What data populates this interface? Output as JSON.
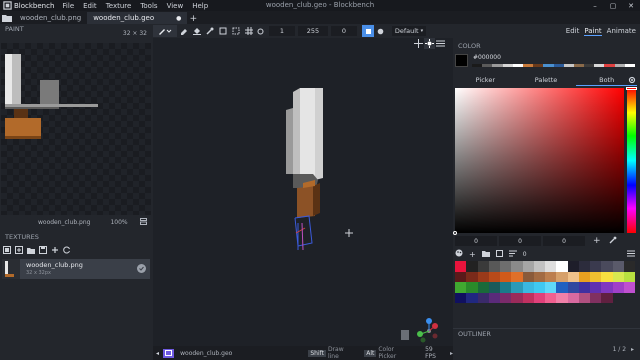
{
  "app": {
    "name": "Blockbench",
    "window_title": "wooden_club.geo - Blockbench",
    "menu": [
      "File",
      "Edit",
      "Texture",
      "Tools",
      "View",
      "Help"
    ],
    "window_controls": [
      "–",
      "▢",
      "✕"
    ]
  },
  "tabs": [
    {
      "label": "wooden_club.png",
      "active": false
    },
    {
      "label": "wooden_club.geo",
      "active": true,
      "modified_dot": "●",
      "close": "×"
    }
  ],
  "left_panel": {
    "paint_title": "PAINT",
    "paint_size": "32 × 32",
    "paint_file": "wooden_club.png",
    "paint_zoom": "100%",
    "textures_title": "TEXTURES",
    "texture": {
      "name": "wooden_club.png",
      "size": "32 x 32px"
    }
  },
  "toolbar": {
    "fields": [
      "1",
      "255",
      "0"
    ],
    "view_mode": "Default"
  },
  "mode_tabs": [
    {
      "label": "Edit",
      "active": false
    },
    {
      "label": "Paint",
      "active": true
    },
    {
      "label": "Animate",
      "active": false
    }
  ],
  "color_panel": {
    "title": "COLOR",
    "hex": "#000000",
    "subtabs": [
      {
        "label": "Picker",
        "active": false
      },
      {
        "label": "Palette",
        "active": false
      },
      {
        "label": "Both",
        "active": true
      }
    ],
    "inputs": [
      "0",
      "0",
      "0"
    ],
    "add_symbol": "+",
    "recent_colors": [
      "#1a1a1a",
      "#5a5a5a",
      "#9a9a9a",
      "#d6d6d6",
      "#ffffff",
      "#c87a3a",
      "#6b3a1a",
      "#4a90d0",
      "#2a5a9a",
      "#c8c8c8",
      "#8a6a4a",
      "#3a3a3a",
      "#d8d8d8",
      "#e04040",
      "#b0b0b0",
      "#ffffff"
    ],
    "palette": [
      "#e8143c",
      "#222222",
      "#3a3a3a",
      "#585858",
      "#6e6e6e",
      "#8a8a8a",
      "#a6a6a6",
      "#c2c2c2",
      "#dedede",
      "#ffffff",
      "#1e1e2a",
      "#2c2c3c",
      "#3a3a4e",
      "#4a4a5c",
      "#5a5a6a",
      "#2a2a2a",
      "#5a1a1a",
      "#7a2a1a",
      "#9a3a1a",
      "#b84a1a",
      "#d25a1a",
      "#e0702a",
      "#8a5a3a",
      "#a26a42",
      "#bc7e4e",
      "#d6a06a",
      "#f0c28a",
      "#e8a020",
      "#f0c030",
      "#f8e040",
      "#d8e850",
      "#b8e040",
      "#40a830",
      "#2a8a2a",
      "#1a6a3a",
      "#1a5a5a",
      "#1a7a8a",
      "#2a9ab8",
      "#3ab8e0",
      "#40c8f0",
      "#60d8f8",
      "#2060c0",
      "#3048a0",
      "#4030a0",
      "#6030b0",
      "#8038c0",
      "#a040c8",
      "#c050d0",
      "#101060",
      "#202880",
      "#3a2a6a",
      "#5a2a7a",
      "#7a2a6a",
      "#9a2a5a",
      "#c03060",
      "#e0407a",
      "#f06090",
      "#f080a8",
      "#d86aa0",
      "#b05080",
      "#803060",
      "#602040",
      "#23262c",
      "#23262c"
    ],
    "palette_zero": "0"
  },
  "outline": {
    "title": "OUTLINER",
    "page": "1 / 2"
  },
  "statusbar": {
    "file": "wooden_club.geo",
    "key1": "Shift",
    "key1_label": "Draw line",
    "key2": "Alt",
    "key2_label": "Color Picker",
    "fps": "59 FPS"
  }
}
